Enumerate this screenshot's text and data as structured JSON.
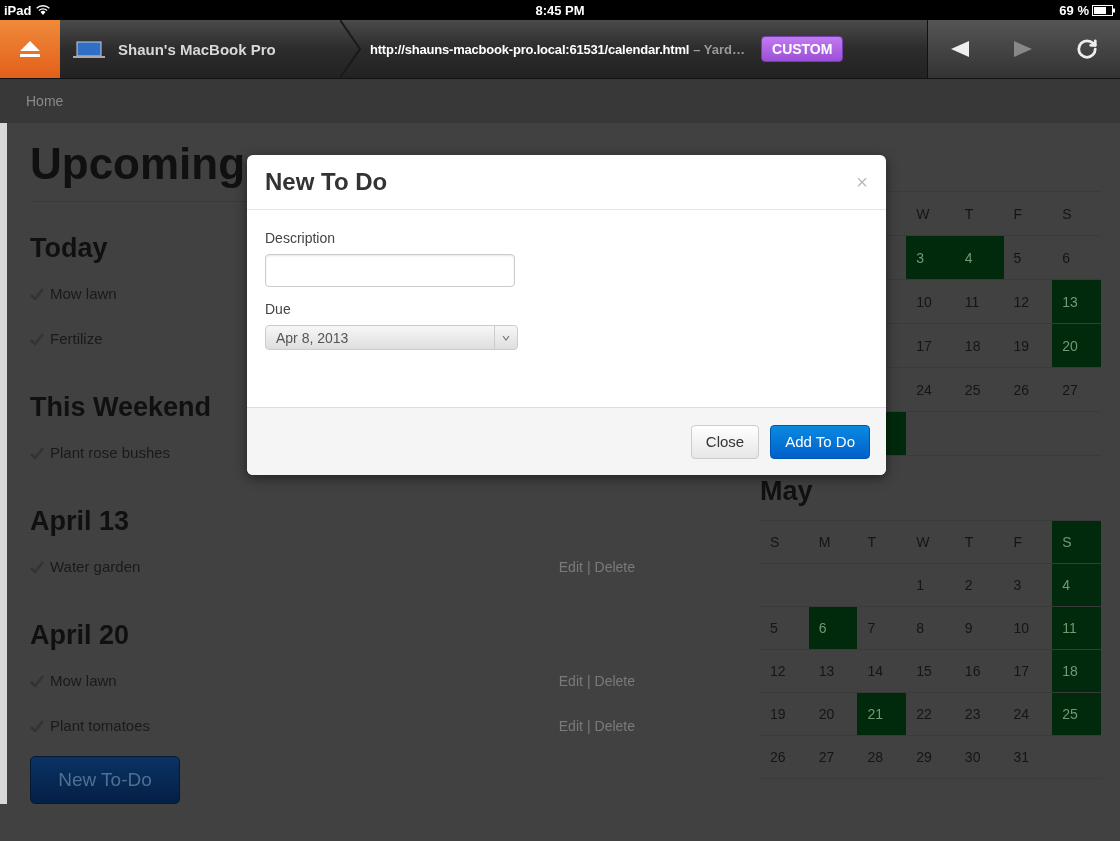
{
  "status_bar": {
    "device": "iPad",
    "time": "8:45 PM",
    "battery": "69 %"
  },
  "browser": {
    "host": "Shaun's MacBook Pro",
    "url": "http://shauns-macbook-pro.local:61531/calendar.html",
    "page_title": "– Yard…",
    "badge": "CUSTOM"
  },
  "breadcrumb": [
    "Home"
  ],
  "page": {
    "title": "Upcoming",
    "sections": [
      {
        "heading": "Today",
        "items": [
          {
            "text": "Mow lawn"
          },
          {
            "text": "Fertilize"
          }
        ]
      },
      {
        "heading": "This Weekend",
        "items": [
          {
            "text": "Plant rose bushes"
          }
        ]
      },
      {
        "heading": "April 13",
        "items": [
          {
            "text": "Water garden",
            "actions": {
              "edit": "Edit",
              "separator": "|",
              "delete": "Delete"
            }
          }
        ]
      },
      {
        "heading": "April 20",
        "items": [
          {
            "text": "Mow lawn",
            "actions": {
              "edit": "Edit",
              "separator": "|",
              "delete": "Delete"
            }
          },
          {
            "text": "Plant tomatoes",
            "actions": {
              "edit": "Edit",
              "separator": "|",
              "delete": "Delete"
            }
          }
        ]
      }
    ],
    "new_button": "New To-Do"
  },
  "calendars": [
    {
      "kind": "covered",
      "weekdays": [
        {
          "marked": false
        },
        {
          "label": "W",
          "marked": false
        },
        {
          "label": "T",
          "marked": false
        },
        {
          "label": "F",
          "marked": false
        },
        {
          "label": "S",
          "marked": false
        }
      ],
      "weeks": [
        [
          {
            "marked": false
          },
          {
            "day": "3",
            "marked": true
          },
          {
            "day": "4",
            "marked": true
          },
          {
            "day": "5",
            "marked": false
          },
          {
            "day": "6",
            "marked": false
          }
        ],
        [
          {
            "marked": false
          },
          {
            "day": "10",
            "marked": false
          },
          {
            "day": "11",
            "marked": false
          },
          {
            "day": "12",
            "marked": false
          },
          {
            "day": "13",
            "marked": true
          }
        ],
        [
          {
            "marked": false
          },
          {
            "day": "17",
            "marked": false
          },
          {
            "day": "18",
            "marked": false
          },
          {
            "day": "19",
            "marked": false
          },
          {
            "day": "20",
            "marked": true
          }
        ],
        [
          {
            "marked": false
          },
          {
            "day": "24",
            "marked": false
          },
          {
            "day": "25",
            "marked": false
          },
          {
            "day": "26",
            "marked": false
          },
          {
            "day": "27",
            "marked": false
          }
        ],
        [
          {
            "marked": true
          },
          {
            "marked": false
          },
          {
            "marked": false
          },
          {
            "marked": false
          },
          {
            "marked": false
          }
        ]
      ]
    },
    {
      "kind": "full",
      "month": "May",
      "weekdays": [
        {
          "label": "S",
          "marked": false
        },
        {
          "label": "M",
          "marked": false
        },
        {
          "label": "T",
          "marked": false
        },
        {
          "label": "W",
          "marked": false
        },
        {
          "label": "T",
          "marked": false
        },
        {
          "label": "F",
          "marked": false
        },
        {
          "label": "S",
          "marked": true
        }
      ],
      "weeks": [
        [
          {
            "marked": false
          },
          {
            "marked": false
          },
          {
            "marked": false
          },
          {
            "day": "1",
            "marked": false
          },
          {
            "day": "2",
            "marked": false
          },
          {
            "day": "3",
            "marked": false
          },
          {
            "day": "4",
            "marked": true
          }
        ],
        [
          {
            "day": "5",
            "marked": false
          },
          {
            "day": "6",
            "marked": true
          },
          {
            "day": "7",
            "marked": false
          },
          {
            "day": "8",
            "marked": false
          },
          {
            "day": "9",
            "marked": false
          },
          {
            "day": "10",
            "marked": false
          },
          {
            "day": "11",
            "marked": true
          }
        ],
        [
          {
            "day": "12",
            "marked": false
          },
          {
            "day": "13",
            "marked": false
          },
          {
            "day": "14",
            "marked": false
          },
          {
            "day": "15",
            "marked": false
          },
          {
            "day": "16",
            "marked": false
          },
          {
            "day": "17",
            "marked": false
          },
          {
            "day": "18",
            "marked": true
          }
        ],
        [
          {
            "day": "19",
            "marked": false
          },
          {
            "day": "20",
            "marked": false
          },
          {
            "day": "21",
            "marked": true
          },
          {
            "day": "22",
            "marked": false
          },
          {
            "day": "23",
            "marked": false
          },
          {
            "day": "24",
            "marked": false
          },
          {
            "day": "25",
            "marked": true
          }
        ],
        [
          {
            "day": "26",
            "marked": false
          },
          {
            "day": "27",
            "marked": false
          },
          {
            "day": "28",
            "marked": false
          },
          {
            "day": "29",
            "marked": false
          },
          {
            "day": "30",
            "marked": false
          },
          {
            "day": "31",
            "marked": false
          },
          {
            "marked": false
          }
        ]
      ]
    }
  ],
  "modal": {
    "title": "New To Do",
    "close": "×",
    "fields": [
      {
        "kind": "text",
        "label": "Description"
      },
      {
        "kind": "select",
        "label": "Due",
        "value": "Apr 8, 2013"
      }
    ],
    "buttons": [
      {
        "label": "Close",
        "primary": false
      },
      {
        "label": "Add To Do",
        "primary": true
      }
    ]
  }
}
